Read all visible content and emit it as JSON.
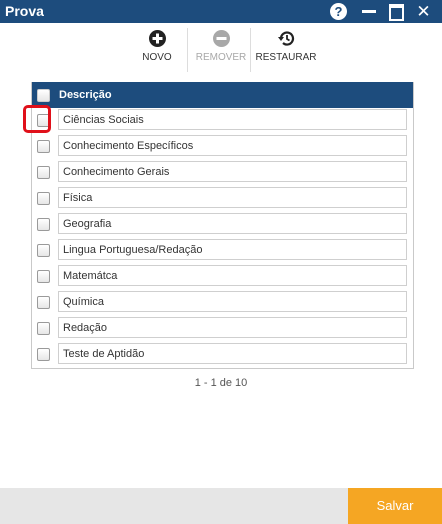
{
  "window": {
    "title": "Prova"
  },
  "toolbar": {
    "novo_label": "NOVO",
    "remover_label": "REMOVER",
    "restaurar_label": "RESTAURAR"
  },
  "grid": {
    "column_header": "Descrição",
    "rows": [
      "Ciências Sociais",
      "Conhecimento Específicos",
      "Conhecimento Gerais",
      "Física",
      "Geografia",
      "Lingua Portuguesa/Redação",
      "Matemátca",
      "Química",
      "Redação",
      "Teste de Aptidão"
    ]
  },
  "pager": {
    "text": "1 - 1 de 10"
  },
  "footer": {
    "save_label": "Salvar"
  },
  "colors": {
    "header_blue": "#1d4c7d",
    "save_orange": "#f5a623",
    "highlight_red": "#e0101a"
  }
}
